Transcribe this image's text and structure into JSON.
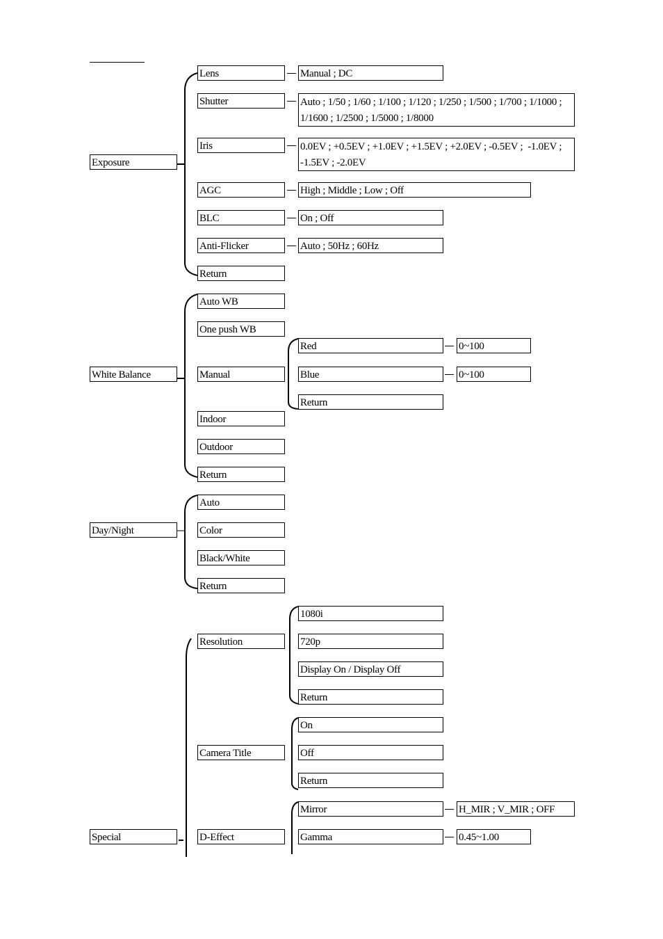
{
  "diagram": {
    "exposure": {
      "label": "Exposure",
      "items": [
        {
          "label": "Lens",
          "options": "Manual ; DC"
        },
        {
          "label": "Shutter",
          "options": "Auto ; 1/50 ; 1/60 ; 1/100 ; 1/120 ; 1/250 ; 1/500 ; 1/700 ; 1/1000 ; 1/1600 ; 1/2500 ; 1/5000 ; 1/8000"
        },
        {
          "label": "Iris",
          "options": "0.0EV ; +0.5EV ; +1.0EV ; +1.5EV ; +2.0EV ; -0.5EV ;  -1.0EV ; -1.5EV ; -2.0EV"
        },
        {
          "label": "AGC",
          "options": "High ; Middle ; Low ; Off"
        },
        {
          "label": "BLC",
          "options": "On ; Off"
        },
        {
          "label": "Anti-Flicker",
          "options": "Auto ; 50Hz ; 60Hz"
        },
        {
          "label": "Return"
        }
      ]
    },
    "white_balance": {
      "label": "White Balance",
      "items": [
        {
          "label": "Auto WB"
        },
        {
          "label": "One push WB"
        },
        {
          "label": "Manual",
          "sub": [
            {
              "label": "Red",
              "options": "0~100"
            },
            {
              "label": "Blue",
              "options": "0~100"
            },
            {
              "label": "Return"
            }
          ]
        },
        {
          "label": "Indoor"
        },
        {
          "label": "Outdoor"
        },
        {
          "label": "Return"
        }
      ]
    },
    "day_night": {
      "label": "Day/Night",
      "items": [
        {
          "label": "Auto"
        },
        {
          "label": "Color"
        },
        {
          "label": "Black/White"
        },
        {
          "label": "Return"
        }
      ]
    },
    "special": {
      "label": "Special",
      "items": [
        {
          "label": "Resolution",
          "sub": [
            {
              "label": "1080i"
            },
            {
              "label": "720p"
            },
            {
              "label": "Display On / Display Off"
            },
            {
              "label": "Return"
            }
          ]
        },
        {
          "label": "Camera Title",
          "sub": [
            {
              "label": "On"
            },
            {
              "label": "Off"
            },
            {
              "label": "Return"
            }
          ]
        },
        {
          "label": "D-Effect",
          "sub": [
            {
              "label": "Mirror",
              "options": "H_MIR ; V_MIR ; OFF"
            },
            {
              "label": "Gamma",
              "options": "0.45~1.00"
            }
          ]
        }
      ]
    }
  }
}
